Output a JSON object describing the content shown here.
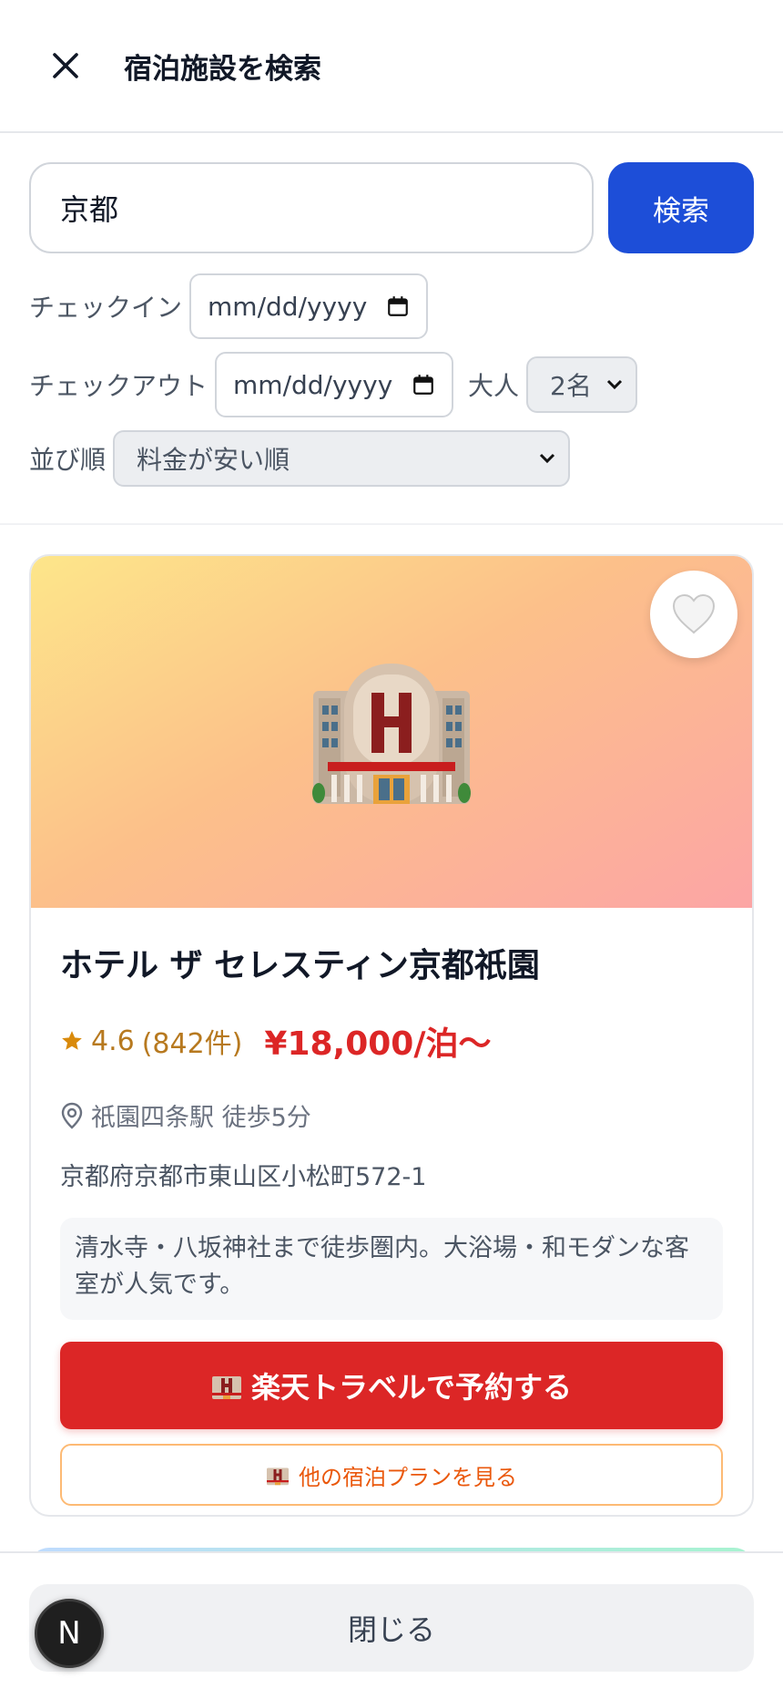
{
  "header": {
    "title": "宿泊施設を検索"
  },
  "search": {
    "value": "京都",
    "button_label": "検索"
  },
  "checkin": {
    "label": "チェックイン",
    "placeholder": "mm/dd/yyyy"
  },
  "checkout": {
    "label": "チェックアウト",
    "placeholder": "mm/dd/yyyy"
  },
  "adults": {
    "label": "大人",
    "selected": "2名"
  },
  "sort": {
    "label": "並び順",
    "selected": "料金が安い順"
  },
  "hotel": {
    "name": "ホテル ザ セレスティン京都祇園",
    "rating": "4.6",
    "review_count": "(842件)",
    "price": "¥18,000/泊〜",
    "access": "祇園四条駅 徒歩5分",
    "address": "京都府京都市東山区小松町572-1",
    "description": "清水寺・八坂神社まで徒歩圏内。大浴場・和モダンな客室が人気です。",
    "book_label": "楽天トラベルで予約する",
    "plans_label": "他の宿泊プランを見る",
    "icons": {
      "hero": "hotel-icon",
      "favorite": "white-heart-icon",
      "rating": "star-icon",
      "access": "location-pin-icon"
    }
  },
  "footer": {
    "close_label": "閉じる",
    "badge_letter": "N"
  },
  "colors": {
    "primary": "#1d4ed8",
    "book": "#dc2626",
    "price": "#dc2626",
    "rating": "#b7791f",
    "plan_border": "#fdba74"
  }
}
